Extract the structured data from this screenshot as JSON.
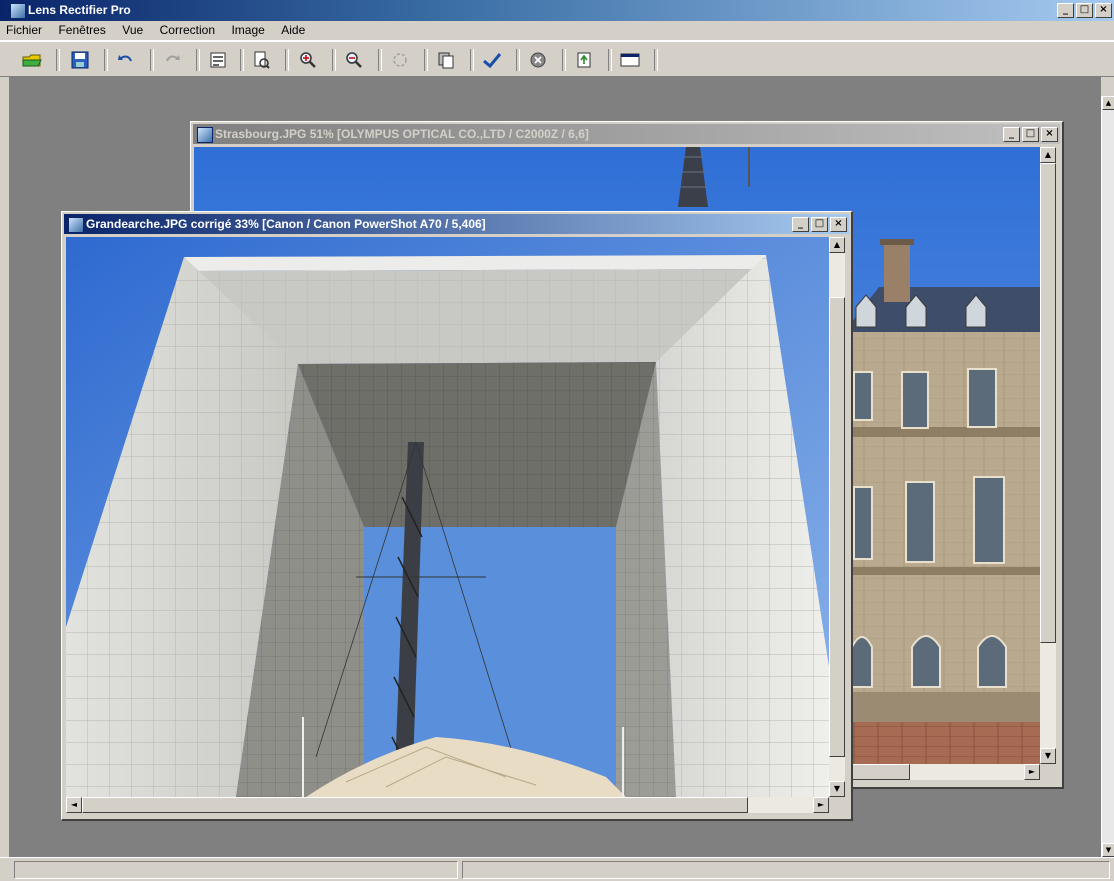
{
  "app": {
    "title": "Lens Rectifier Pro",
    "window_buttons": {
      "minimize": "_",
      "maximize": "□",
      "close": "×"
    }
  },
  "menu": [
    "Fichier",
    "Fenêtres",
    "Vue",
    "Correction",
    "Image",
    "Aide"
  ],
  "toolbar": {
    "icons": [
      "open-icon",
      "save-icon",
      "undo-icon",
      "redo-icon",
      "properties-icon",
      "print-preview-icon",
      "zoom-in-icon",
      "zoom-out-icon",
      "rotate-icon",
      "copy-icon",
      "correct-icon",
      "stop-icon",
      "export-icon",
      "window-icon"
    ]
  },
  "windows": {
    "strasbourg": {
      "title": "Strasbourg.JPG 51%  [OLYMPUS OPTICAL CO.,LTD / C2000Z / 6,6]"
    },
    "grandearche": {
      "title": "Grandearche.JPG corrigé 33%  [Canon / Canon PowerShot A70 / 5,406]"
    }
  },
  "status": {
    "pane1": "",
    "pane2": ""
  },
  "colors": {
    "active_title": "#0a246a",
    "inactive_title": "#808080",
    "mdi_background": "#808080",
    "sky": "#4d83d6"
  }
}
